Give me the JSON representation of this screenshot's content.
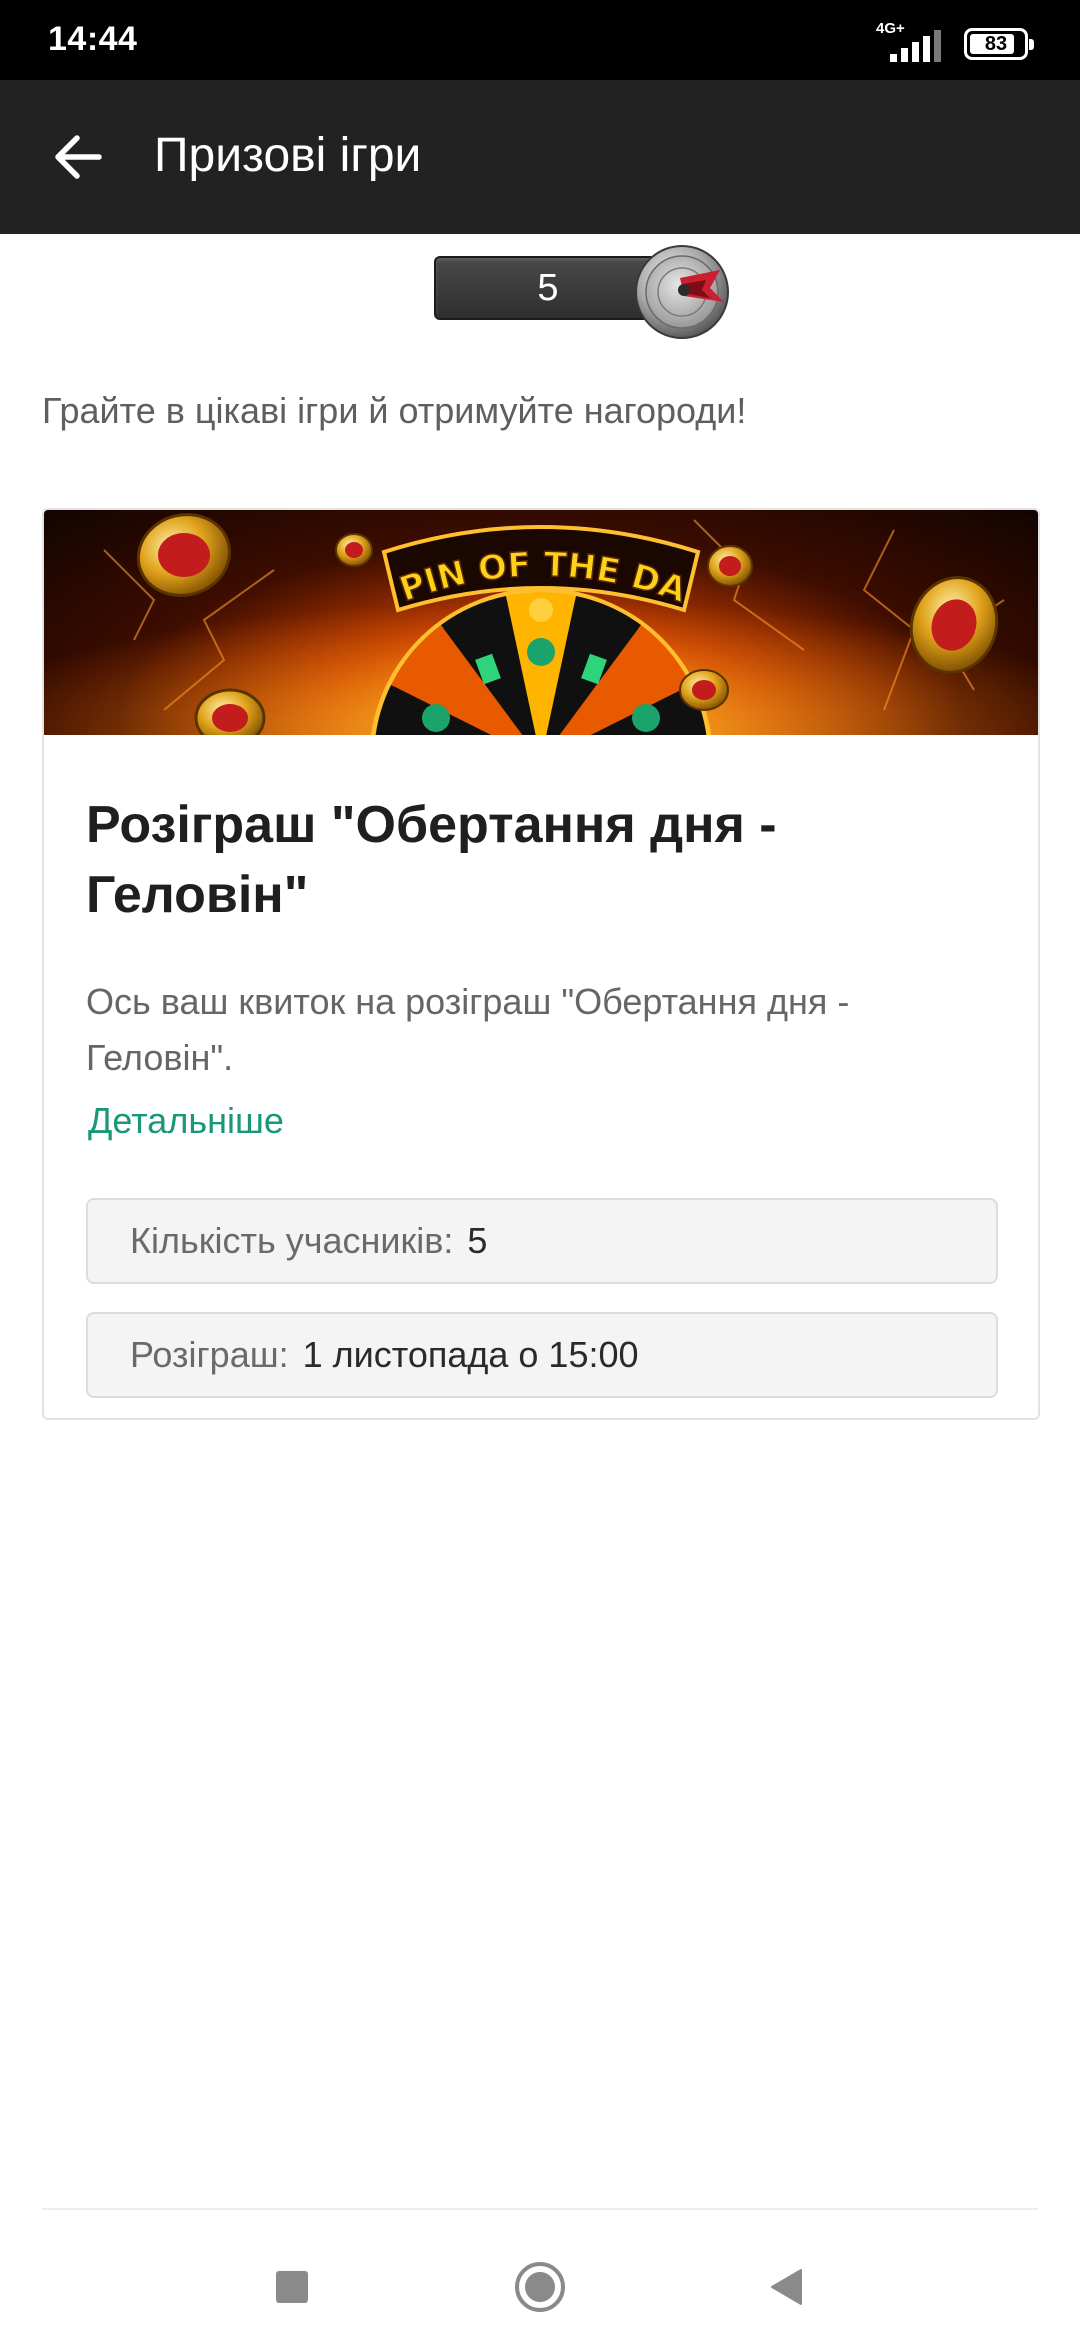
{
  "status_bar": {
    "time": "14:44",
    "network": "4G+",
    "battery": "83"
  },
  "app_bar": {
    "back_icon": "arrow-left-icon",
    "title": "Призові ігри"
  },
  "counter": {
    "value": "5",
    "icon": "dart-target-icon"
  },
  "intro_text": "Грайте в цікаві ігри й отримуйте нагороди!",
  "card": {
    "banner_text": "SPIN OF THE DAY",
    "title": "Розіграш \"Обертання дня - Геловін\"",
    "description": "Ось ваш квиток на розіграш \"Обертання дня - Геловін\".",
    "details_link": "Детальніше",
    "participants_label": "Кількість учасників:",
    "participants_value": "5",
    "draw_label": "Розіграш:",
    "draw_value": "1 листопада о 15:00"
  },
  "nav_bar": {
    "recents_icon": "square-icon",
    "home_icon": "circle-icon",
    "back_icon": "triangle-back-icon"
  },
  "colors": {
    "app_bar": "#222222",
    "link": "#199778",
    "status_bar": "#000000"
  }
}
